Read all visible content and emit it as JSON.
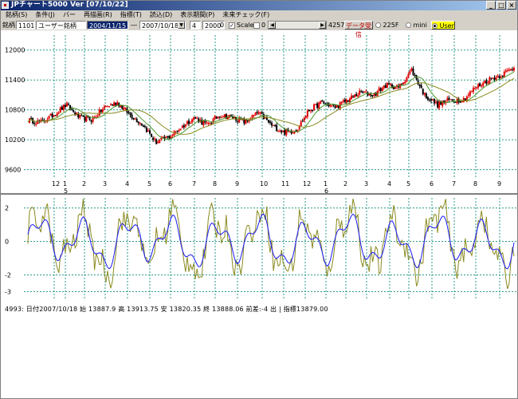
{
  "window": {
    "title": "JPチャート5000  Ver [07/10/22]",
    "controls": [
      "_",
      "□",
      "×"
    ]
  },
  "menu": [
    "銘柄(S)",
    "条件(J)",
    "バー",
    "再描画(R)",
    "指標(T)",
    "読込(D)",
    "表示期間(P)",
    "未来チェック(F)"
  ],
  "toolbar": {
    "code_label": "銘柄",
    "code_value": "1101",
    "name_value": "ユーザー銘柄",
    "start_date": "2004/11/15",
    "dash": "―",
    "end_date": "2007/10/18",
    "n1": "4",
    "n2": "2000",
    "n3": "0",
    "scale_label": "Scale",
    "n4": "0",
    "count": "4257",
    "receive_label": "データ受信",
    "radio_225f": "225F",
    "radio_mini": "mini",
    "radio_user": "User"
  },
  "chart_data": [
    {
      "type": "candlestick",
      "yticks": [
        12000,
        11400,
        10800,
        10200,
        9600
      ],
      "ylim": [
        9450,
        12300
      ],
      "xticks": [
        "12",
        "1",
        "2",
        "3",
        "4",
        "5",
        "6",
        "7",
        "8",
        "9",
        "10",
        "11",
        "12",
        "1",
        "2",
        "3",
        "4",
        "5",
        "6",
        "7",
        "8",
        "9"
      ],
      "year_labels": [
        {
          "label": "5",
          "after_month_index": 1
        },
        {
          "label": "6",
          "after_month_index": 13
        }
      ],
      "close_series_anchors": [
        10600,
        10550,
        10700,
        10900,
        10650,
        10600,
        10850,
        10950,
        10700,
        10500,
        10150,
        10250,
        10450,
        10650,
        10500,
        10700,
        10650,
        10550,
        10750,
        10500,
        10350,
        10400,
        10800,
        10950,
        10850,
        11000,
        11150,
        11100,
        11300,
        11250,
        11600,
        11100,
        10900,
        11000,
        11000,
        11250,
        11400,
        11500,
        11650
      ],
      "moving_averages": [
        {
          "color": "#4a9a2a"
        },
        {
          "color": "#8a8a20"
        }
      ]
    },
    {
      "type": "line",
      "yticks": [
        2,
        0,
        -2,
        -3
      ],
      "ylim": [
        -3.5,
        2.6
      ],
      "series": [
        {
          "color": "#1a1aff"
        },
        {
          "color": "#8a8a20"
        }
      ]
    }
  ],
  "status": {
    "text": "4993:  日付2007/10/18   始 13887.9   高 13913.75   安 13820.35   終 13888.06  前差:-4  出 |  指標13879.00"
  }
}
